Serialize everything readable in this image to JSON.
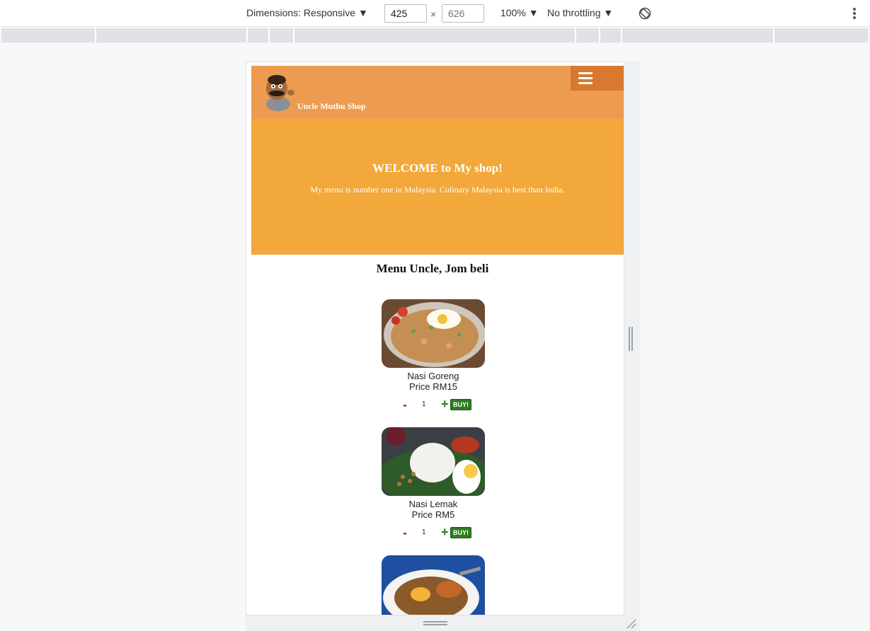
{
  "devtools": {
    "dimensions_label": "Dimensions: Responsive ▼",
    "width_value": "425",
    "height_placeholder": "626",
    "times": "×",
    "zoom_label": "100% ▼",
    "throttle_label": "No throttling ▼",
    "icons": [
      "rotate-icon",
      "more-vertical-icon"
    ]
  },
  "site": {
    "shop_name": "Uncle Muthu Shop",
    "hero_title": "WELCOME to My shop!",
    "hero_text": "My menu is number one in Malaysia. Culinary Malaysia is best than India.",
    "menu_title": "Menu Uncle, Jom beli",
    "items": [
      {
        "name": "Nasi Goreng",
        "price": "Price RM15",
        "qty": "1",
        "minus": "-",
        "plus": "+",
        "buy": "BUY!"
      },
      {
        "name": "Nasi Lemak",
        "price": "Price RM5",
        "qty": "1",
        "minus": "-",
        "plus": "+",
        "buy": "BUY!"
      },
      {
        "name": "",
        "price": "",
        "qty": "",
        "minus": "",
        "plus": "",
        "buy": ""
      }
    ]
  },
  "colors": {
    "header": "#ec9b50",
    "burger": "#d9782f",
    "hero": "#f2a83a",
    "buy": "#2e7d1e",
    "minus": "#c0181b",
    "plus": "#2c7a2c"
  }
}
